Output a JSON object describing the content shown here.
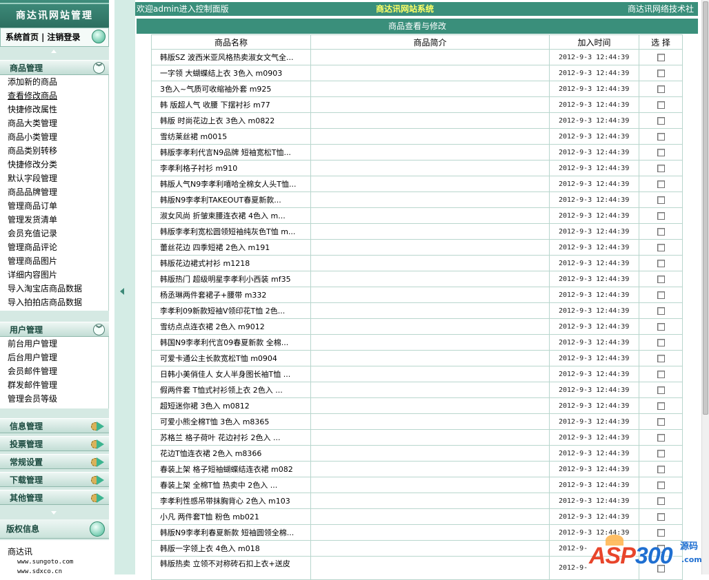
{
  "sidebar": {
    "title": "商达讯网站管理",
    "nav": {
      "home": "系统首页",
      "separator": "|",
      "logout": "注销登录"
    },
    "groups": [
      {
        "title": "商品管理",
        "items": [
          "添加新的商品",
          "查看修改商品",
          "快捷修改属性",
          "商品大类管理",
          "商品小类管理",
          "商品类别转移",
          "快捷修改分类",
          "默认字段管理",
          "商品品牌管理",
          "管理商品订单",
          "管理发货清单",
          "会员充值记录",
          "管理商品评论",
          "管理商品图片",
          "详细内容图片",
          "导入淘宝店商品数据",
          "导入拍拍店商品数据"
        ]
      },
      {
        "title": "用户管理",
        "items": [
          "前台用户管理",
          "后台用户管理",
          "会员邮件管理",
          "群发邮件管理",
          "管理会员等级"
        ]
      }
    ],
    "collapsed_groups": [
      "信息管理",
      "投票管理",
      "常规设置",
      "下载管理",
      "其他管理"
    ],
    "copyright": {
      "title": "版权信息",
      "name": "商达讯",
      "url1": "www.sungoto.com",
      "url2": "www.sdxco.cn"
    }
  },
  "header": {
    "welcome": "欢迎admin进入控制面版",
    "system_name": "商达讯网站系统",
    "company": "商达讯网络技术社"
  },
  "panel": {
    "title": "商品查看与修改",
    "columns": [
      "商品名称",
      "商品简介",
      "加入时间",
      "选 择"
    ],
    "rows": [
      {
        "name": "韩版SZ 波西米亚风格热卖淑女文气全...",
        "time": "2012-9-3 12:44:39"
      },
      {
        "name": "一字领 大蝴蝶结上衣 3色入 m0903",
        "time": "2012-9-3 12:44:39"
      },
      {
        "name": "3色入~气质可收缩袖外套 m925",
        "time": "2012-9-3 12:44:39"
      },
      {
        "name": "韩 版超人气 收腰 下摆衬衫 m77",
        "time": "2012-9-3 12:44:39"
      },
      {
        "name": "韩版 时尚花边上衣 3色入 m0822",
        "time": "2012-9-3 12:44:39"
      },
      {
        "name": "雪纺莱丝裙 m0015",
        "time": "2012-9-3 12:44:39"
      },
      {
        "name": "韩版李孝利代言N9品牌 短袖宽松T恤...",
        "time": "2012-9-3 12:44:39"
      },
      {
        "name": "李孝利格子衬衫 m910",
        "time": "2012-9-3 12:44:39"
      },
      {
        "name": "韩版人气N9李孝利嘻哈全棉女人头T恤...",
        "time": "2012-9-3 12:44:39"
      },
      {
        "name": "韩版N9李孝利TAKEOUT春夏新款...",
        "time": "2012-9-3 12:44:39"
      },
      {
        "name": "淑女风尚 折皱束腰连衣裙 4色入 m...",
        "time": "2012-9-3 12:44:39"
      },
      {
        "name": "韩版李孝利宽松圆领短袖纯灰色T恤 m...",
        "time": "2012-9-3 12:44:39"
      },
      {
        "name": "蕾丝花边 四季短裙 2色入 m191",
        "time": "2012-9-3 12:44:39"
      },
      {
        "name": "韩版花边裙式衬衫 m1218",
        "time": "2012-9-3 12:44:39"
      },
      {
        "name": "韩版热门 超级明星李孝利小西装 mf35",
        "time": "2012-9-3 12:44:39"
      },
      {
        "name": "杨丞琳两件套裙子+腰带 m332",
        "time": "2012-9-3 12:44:39"
      },
      {
        "name": "李孝利09新款短袖V领印花T恤 2色...",
        "time": "2012-9-3 12:44:39"
      },
      {
        "name": "雪纺点点连衣裙 2色入 m9012",
        "time": "2012-9-3 12:44:39"
      },
      {
        "name": "韩国N9李孝利代言09春夏新款 全棉...",
        "time": "2012-9-3 12:44:39"
      },
      {
        "name": "可爱卡通公主长款宽松T恤 m0904",
        "time": "2012-9-3 12:44:39"
      },
      {
        "name": "日韩小美俏佳人 女人半身图长袖T恤 ...",
        "time": "2012-9-3 12:44:39"
      },
      {
        "name": "假两件套 T恤式衬衫领上衣 2色入 ...",
        "time": "2012-9-3 12:44:39"
      },
      {
        "name": "超短迷你裙 3色入 m0812",
        "time": "2012-9-3 12:44:39"
      },
      {
        "name": "可爱小熊全棉T恤 3色入 m8365",
        "time": "2012-9-3 12:44:39"
      },
      {
        "name": "苏格兰 格子荷叶 花边衬衫 2色入 ...",
        "time": "2012-9-3 12:44:39"
      },
      {
        "name": "花边T恤连衣裙 2色入 m8366",
        "time": "2012-9-3 12:44:39"
      },
      {
        "name": "春装上架 格子短袖蝴蝶结连衣裙 m082",
        "time": "2012-9-3 12:44:39"
      },
      {
        "name": "春装上架 全棉T恤 热卖中 2色入 ...",
        "time": "2012-9-3 12:44:39"
      },
      {
        "name": "李孝利性感吊带抹胸背心 2色入 m103",
        "time": "2012-9-3 12:44:39"
      },
      {
        "name": "小凡 两件套T恤 粉色 mb021",
        "time": "2012-9-3 12:44:39"
      },
      {
        "name": "韩版N9李孝利春夏新款 短袖圆领全棉...",
        "time": "2012-9-3 12:44:39"
      },
      {
        "name": "韩版一字领上衣 4色入 m018",
        "time": "2012-9-"
      },
      {
        "name": "韩版热卖 立领不对称砖石扣上衣+送皮",
        "time": "2012-9-"
      }
    ]
  },
  "watermark": {
    "brand_left": "ASP",
    "brand_num": "300",
    "brand_cn": "源码",
    "brand_com": ".com"
  },
  "colors": {
    "header_bg": "#3a8f7b",
    "sidebar_bg": "#d5e9e3",
    "system_name": "#ffff66"
  }
}
